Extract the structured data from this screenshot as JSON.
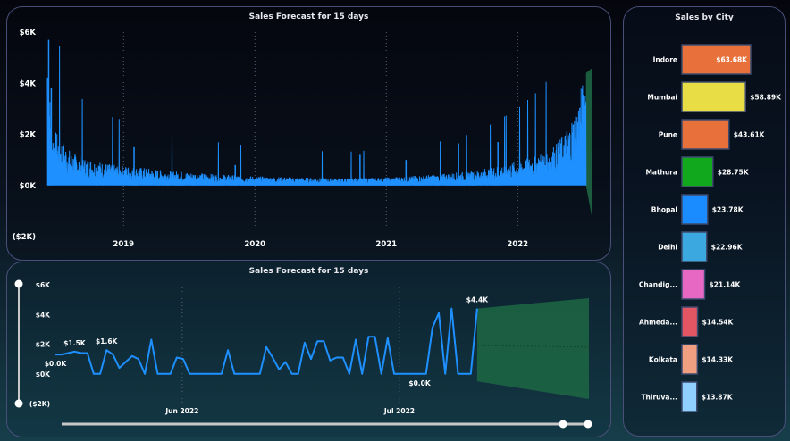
{
  "chart_data": [
    {
      "type": "line",
      "title": "Sales Forecast for 15 days",
      "y_tick_labels": [
        "$6K",
        "$4K",
        "$2K",
        "$0K",
        "($2K)"
      ],
      "y_ticks": [
        6000,
        4000,
        2000,
        0,
        -2000
      ],
      "ylim": [
        -2000,
        6000
      ],
      "x_tick_labels": [
        "2019",
        "2020",
        "2021",
        "2022"
      ],
      "grid": "vertical dotted at year marks",
      "series": [
        {
          "color": "#1e90ff",
          "description_free": true,
          "x_years": [
            2018.42,
            2018.43,
            2018.45,
            2018.5,
            2018.6,
            2018.7,
            2018.8,
            2018.9,
            2019.0,
            2019.1,
            2019.2,
            2019.3,
            2019.4,
            2019.5,
            2019.6,
            2019.7,
            2019.8,
            2019.9,
            2020.0,
            2020.1,
            2020.2,
            2020.3,
            2020.4,
            2020.5,
            2020.6,
            2020.7,
            2020.8,
            2020.9,
            2021.0,
            2021.1,
            2021.2,
            2021.3,
            2021.4,
            2021.5,
            2021.6,
            2021.7,
            2021.8,
            2021.9,
            2022.0,
            2022.1,
            2022.2,
            2022.3,
            2022.35,
            2022.4,
            2022.45,
            2022.5,
            2022.52
          ],
          "values": [
            5700,
            4000,
            1900,
            1700,
            1100,
            900,
            800,
            700,
            650,
            600,
            560,
            500,
            470,
            430,
            400,
            370,
            350,
            330,
            300,
            290,
            280,
            270,
            260,
            250,
            240,
            240,
            250,
            260,
            270,
            290,
            310,
            340,
            370,
            410,
            450,
            520,
            600,
            700,
            800,
            950,
            1100,
            1400,
            1700,
            2100,
            2700,
            3500,
            4400
          ]
        }
      ],
      "forecast": {
        "color": "#1e6b45"
      }
    },
    {
      "type": "line",
      "title": "Sales Forecast for 15 days",
      "y_tick_labels": [
        "$6K",
        "$4K",
        "$2K",
        "$0K",
        "($2K)"
      ],
      "y_ticks": [
        6000,
        4000,
        2000,
        0,
        -2000
      ],
      "ylim": [
        -2000,
        6000
      ],
      "x_tick_labels": [
        "Jun 2022",
        "Jul 2022"
      ],
      "data_labels": [
        {
          "text": "$1.5K",
          "index": 3
        },
        {
          "text": "$1.6K",
          "index": 8
        },
        {
          "text": "$0.0K",
          "index": 0,
          "below": true
        },
        {
          "text": "$0.0K",
          "index": 57,
          "below": true
        },
        {
          "text": "$4.4K",
          "index": 66
        }
      ],
      "series": [
        {
          "color": "#1e90ff",
          "values": [
            1300,
            1300,
            1400,
            1500,
            1400,
            1400,
            0,
            0,
            1600,
            1300,
            400,
            800,
            1200,
            1000,
            0,
            2300,
            0,
            0,
            0,
            1100,
            1000,
            0,
            0,
            0,
            0,
            0,
            0,
            1600,
            0,
            0,
            0,
            0,
            0,
            1800,
            1100,
            300,
            800,
            0,
            0,
            2100,
            1000,
            2200,
            2200,
            900,
            1100,
            1100,
            0,
            2300,
            0,
            2500,
            2500,
            0,
            2400,
            0,
            0,
            0,
            0,
            0,
            0,
            3100,
            4100,
            0,
            4400,
            0,
            0,
            0,
            4400
          ]
        }
      ],
      "forecast": {
        "color": "#1e6b45",
        "upper": [
          4600,
          5100
        ],
        "lower": [
          -500,
          -1700
        ]
      }
    },
    {
      "type": "bar",
      "orientation": "horizontal",
      "title": "Sales by City",
      "categories": [
        "Indore",
        "Mumbai",
        "Pune",
        "Mathura",
        "Bhopal",
        "Delhi",
        "Chandig...",
        "Ahmeda...",
        "Kolkata",
        "Thiruva..."
      ],
      "values": [
        63.68,
        58.89,
        43.61,
        28.75,
        23.78,
        22.96,
        21.14,
        14.54,
        14.33,
        13.87
      ],
      "value_labels": [
        "$63.68K",
        "$58.89K",
        "$43.61K",
        "$28.75K",
        "$23.78K",
        "$22.96K",
        "$21.14K",
        "$14.54K",
        "$14.33K",
        "$13.87K"
      ],
      "colors": [
        "#e8703a",
        "#e8dd45",
        "#e8703a",
        "#12a81e",
        "#1b8cff",
        "#3ba8e0",
        "#e668c2",
        "#e25562",
        "#f0a080",
        "#8fd0ff"
      ]
    }
  ]
}
